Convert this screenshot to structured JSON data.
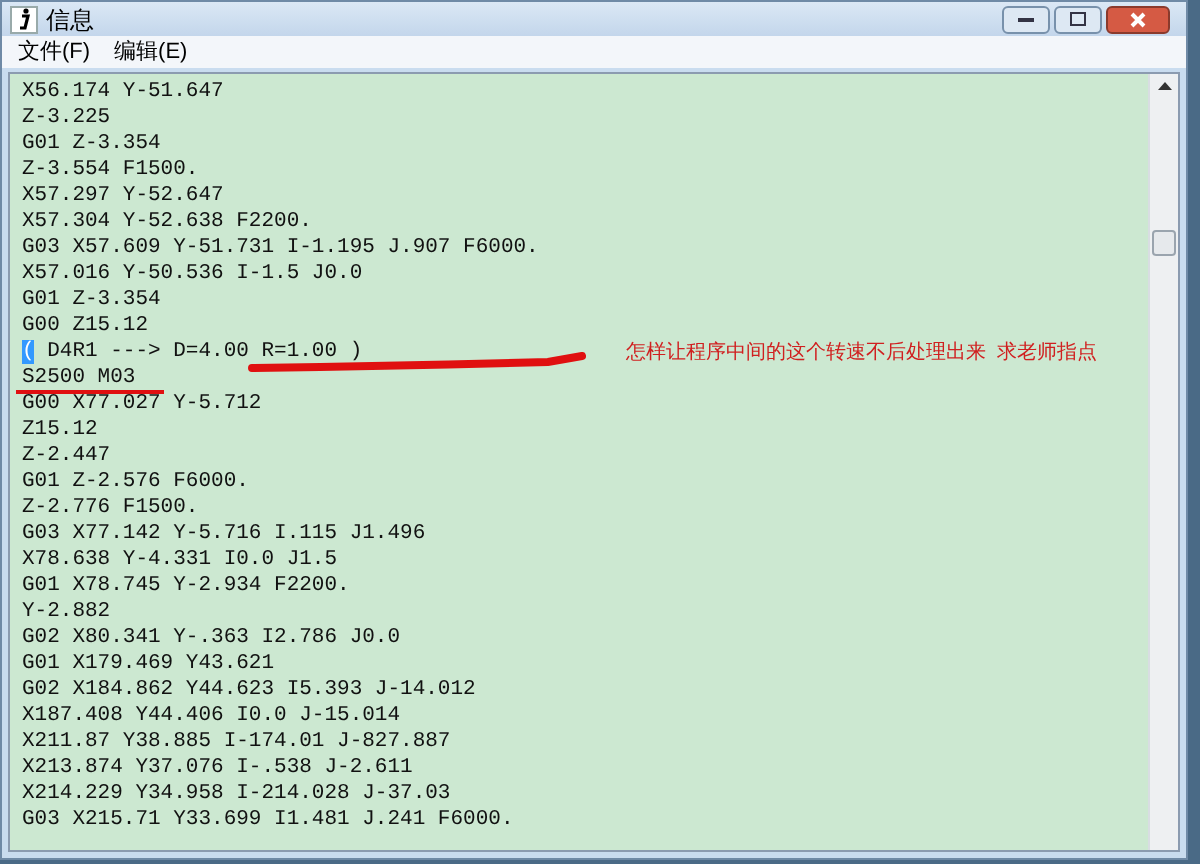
{
  "window": {
    "title": "信息"
  },
  "menu": [
    {
      "label": "文件(F)"
    },
    {
      "label": "编辑(E)"
    }
  ],
  "code_lines": [
    {
      "text": "X56.174 Y-51.647"
    },
    {
      "text": "Z-3.225"
    },
    {
      "text": "G01 Z-3.354"
    },
    {
      "text": "Z-3.554 F1500."
    },
    {
      "text": "X57.297 Y-52.647"
    },
    {
      "text": "X57.304 Y-52.638 F2200."
    },
    {
      "text": "G03 X57.609 Y-51.731 I-1.195 J.907 F6000."
    },
    {
      "text": "X57.016 Y-50.536 I-1.5 J0.0"
    },
    {
      "text": "G01 Z-3.354"
    },
    {
      "text": "G00 Z15.12"
    },
    {
      "selected_text": "(",
      "text": " D4R1 ---> D=4.00 R=1.00 )"
    },
    {
      "text": "S2500 M03"
    },
    {
      "text": "G00 X77.027 Y-5.712"
    },
    {
      "text": "Z15.12"
    },
    {
      "text": "Z-2.447"
    },
    {
      "text": "G01 Z-2.576 F6000."
    },
    {
      "text": "Z-2.776 F1500."
    },
    {
      "text": "G03 X77.142 Y-5.716 I.115 J1.496"
    },
    {
      "text": "X78.638 Y-4.331 I0.0 J1.5"
    },
    {
      "text": "G01 X78.745 Y-2.934 F2200."
    },
    {
      "text": "Y-2.882"
    },
    {
      "text": "G02 X80.341 Y-.363 I2.786 J0.0"
    },
    {
      "text": "G01 X179.469 Y43.621"
    },
    {
      "text": "G02 X184.862 Y44.623 I5.393 J-14.012"
    },
    {
      "text": "X187.408 Y44.406 I0.0 J-15.014"
    },
    {
      "text": "X211.87 Y38.885 I-174.01 J-827.887"
    },
    {
      "text": "X213.874 Y37.076 I-.538 J-2.611"
    },
    {
      "text": "X214.229 Y34.958 I-214.028 J-37.03"
    },
    {
      "text": "G03 X215.71 Y33.699 I1.481 J.241 F6000."
    }
  ],
  "annotation": {
    "note": "怎样让程序中间的这个转速不后处理出来  求老师指点"
  }
}
